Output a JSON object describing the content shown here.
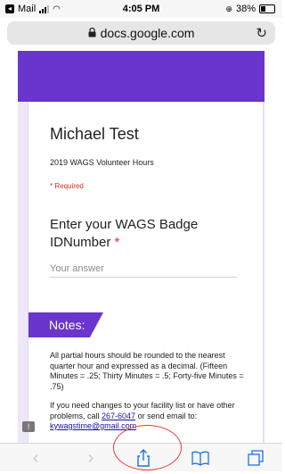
{
  "status_bar": {
    "carrier": "Mail",
    "time": "4:05 PM",
    "battery": "38%",
    "battery_level": 0.38
  },
  "browser": {
    "url": "docs.google.com"
  },
  "form": {
    "title": "Michael Test",
    "description": "2019 WAGS Volunteer Hours",
    "required_note": "* Required",
    "question": "Enter your WAGS Badge IDNumber",
    "required_marker": "*",
    "answer_placeholder": "Your answer",
    "answer_value": ""
  },
  "notes": {
    "heading": "Notes:",
    "paragraph1": "All partial hours should be rounded to the nearest quarter hour and expressed as a decimal. (Fifteen Minutes = .25;  Thirty Minutes = .5;  Forty-five Minutes = .75)",
    "paragraph2_before": "If you need changes to your facility list or have other problems,  call ",
    "phone": "267-6047",
    "paragraph2_middle": " or send email to: ",
    "email": "kywagstime@gmail.com"
  },
  "colors": {
    "accent": "#6a35cc",
    "required": "#d93025",
    "link": "#1a0dab",
    "annotation": "#e53935"
  },
  "icons": {
    "lock": "lock-icon",
    "reload": "reload-icon",
    "back": "back-arrow-icon",
    "forward": "forward-arrow-icon",
    "share": "share-icon",
    "bookmarks": "bookmarks-icon",
    "tabs": "tabs-icon",
    "feedback": "feedback-icon"
  }
}
